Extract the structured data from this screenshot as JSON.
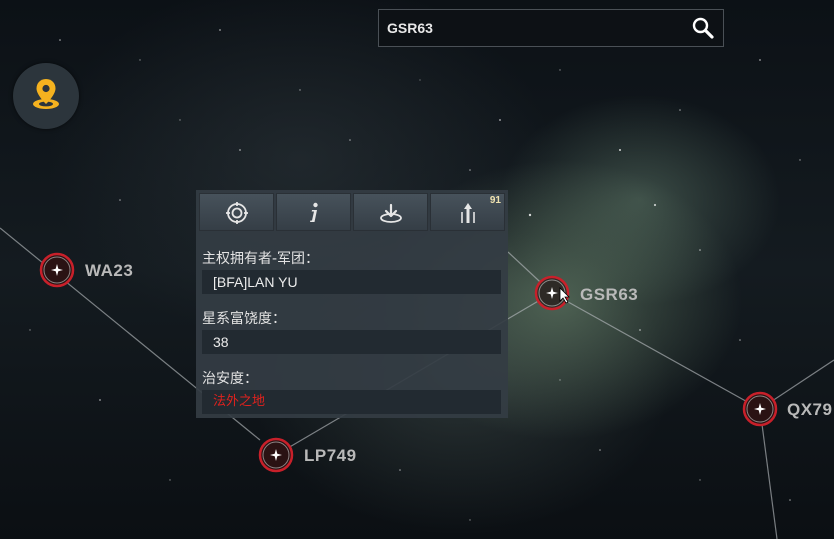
{
  "search": {
    "value": "GSR63"
  },
  "icons": {
    "search": "magnifier-icon",
    "locate": "location-pin-icon",
    "tool1": "target-icon",
    "tool2": "info-icon",
    "tool3": "warp-icon",
    "tool4": "jump-icon"
  },
  "toolbar": {
    "jump_badge": "91"
  },
  "info_panel": {
    "owner_label": "主权拥有者-军团：",
    "owner_value": "[BFA]LAN YU",
    "richness_label": "星系富饶度：",
    "richness_value": "38",
    "security_label": "治安度：",
    "security_value": "法外之地"
  },
  "systems": [
    {
      "name": "WA23"
    },
    {
      "name": "GSR63"
    },
    {
      "name": "LP749"
    },
    {
      "name": "QX79"
    }
  ],
  "colors": {
    "accent": "#f5b21f",
    "node_ring": "#c8202a",
    "danger_text": "#e0221e"
  }
}
